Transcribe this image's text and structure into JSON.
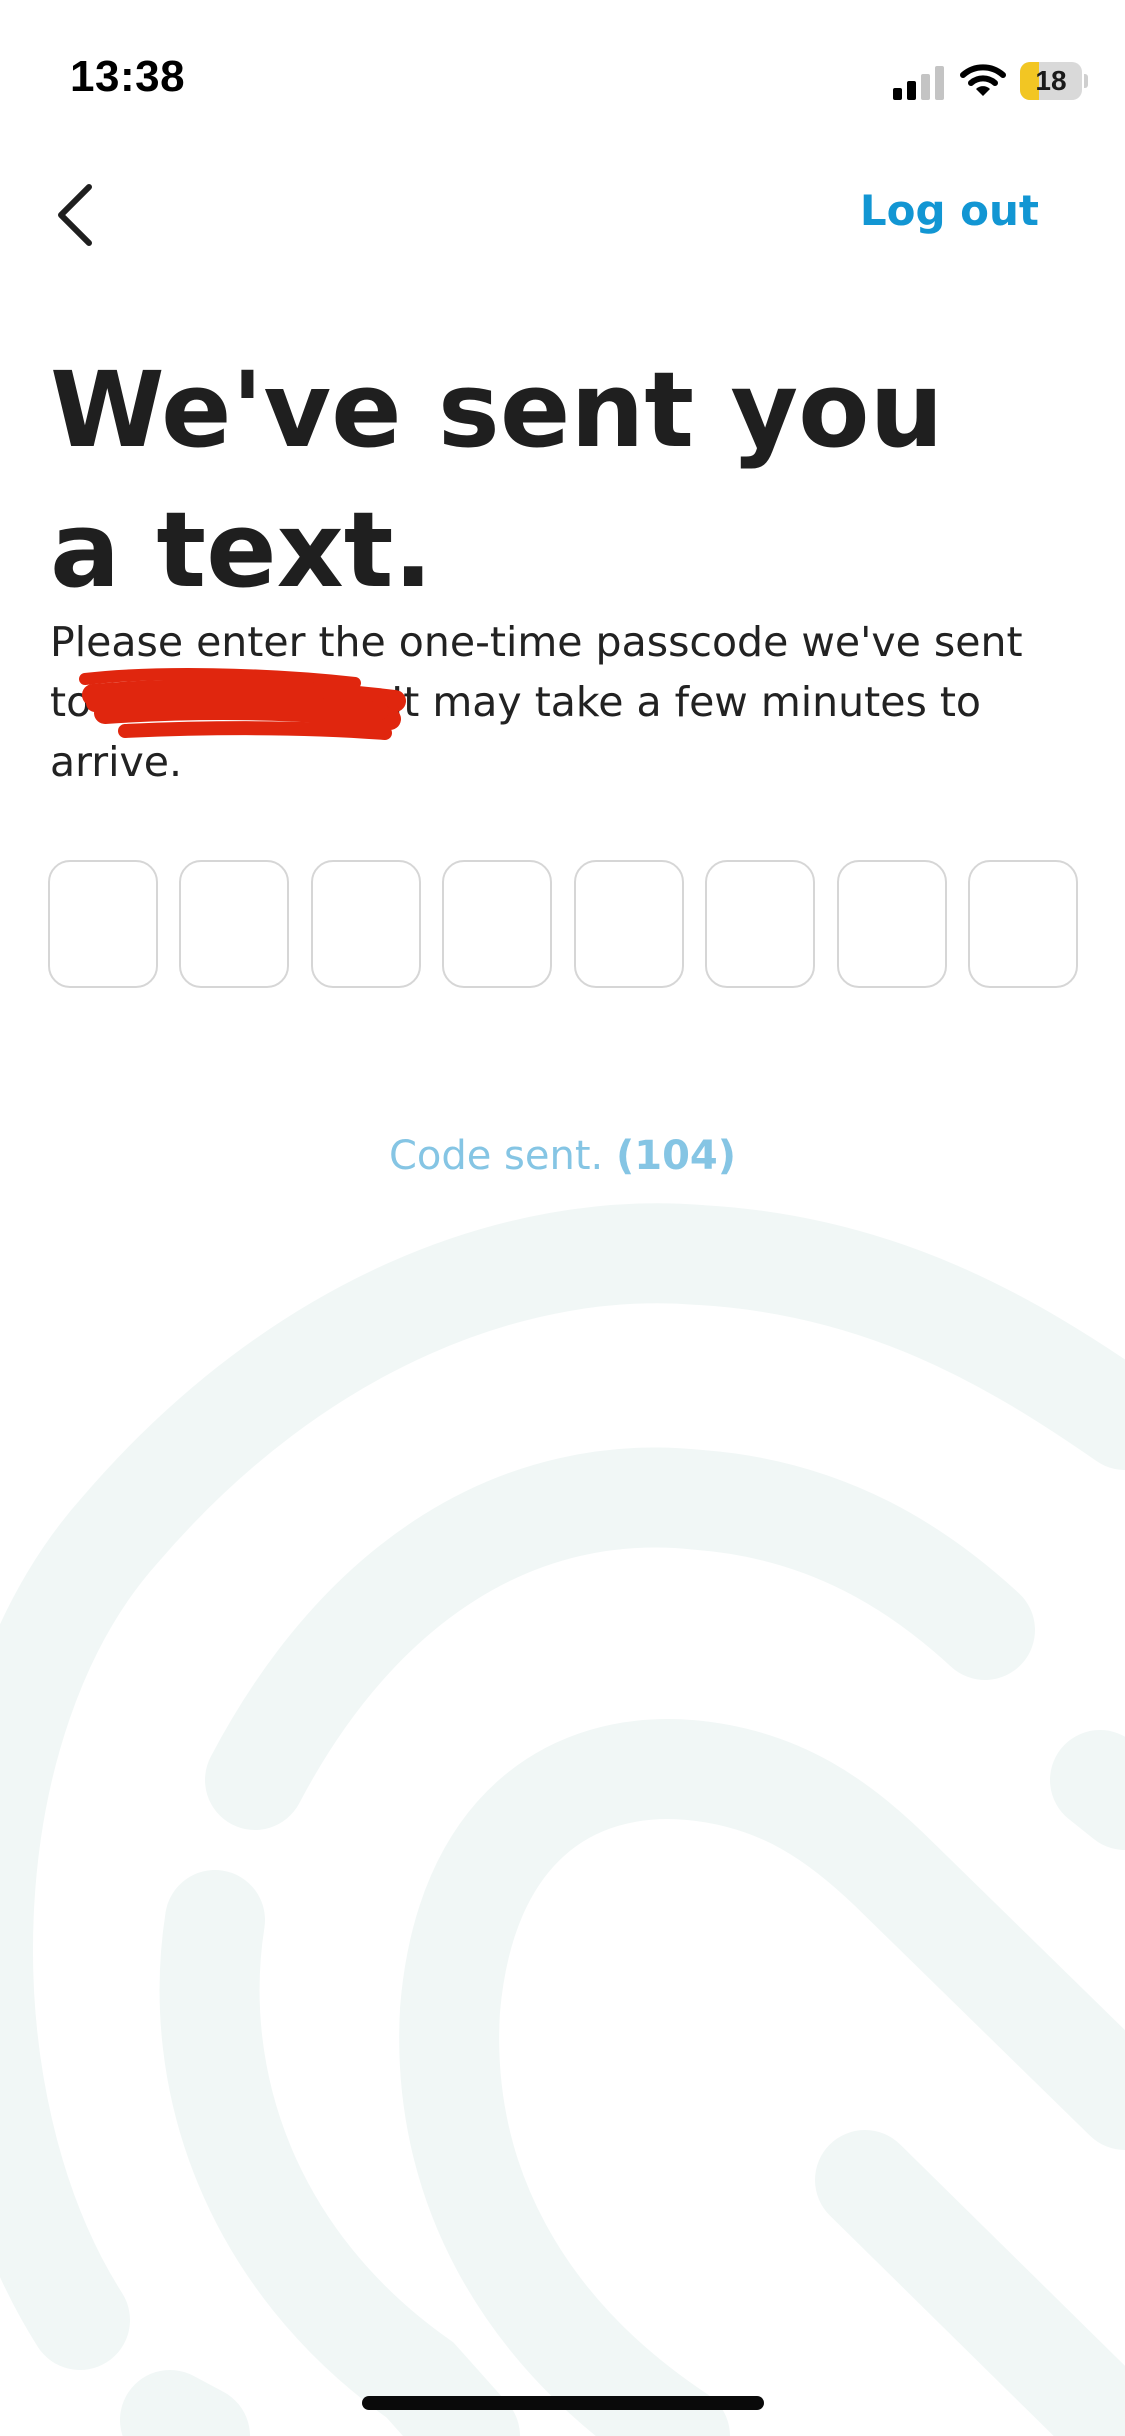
{
  "status_bar": {
    "time": "13:38",
    "battery_level": "18",
    "battery_fraction": 0.18,
    "signal_icon": "cellular-signal-icon",
    "wifi_icon": "wifi-icon"
  },
  "nav": {
    "back_icon": "chevron-left-icon",
    "logout_label": "Log out"
  },
  "heading": {
    "line1": "We've sent you",
    "line2": "a text."
  },
  "description": {
    "prefix": "Please enter the one-time passcode we've sent to",
    "suffix": "It may take a few minutes to arrive."
  },
  "code_input": {
    "length": 8,
    "values": [
      "",
      "",
      "",
      "",
      "",
      "",
      "",
      ""
    ]
  },
  "resend": {
    "label": "Code sent.",
    "countdown": "(104)"
  },
  "colors": {
    "accent": "#1296d3",
    "code_sent_text": "#85c5e4",
    "background_art": "#f1f7f6",
    "redaction": "#e0260e"
  }
}
